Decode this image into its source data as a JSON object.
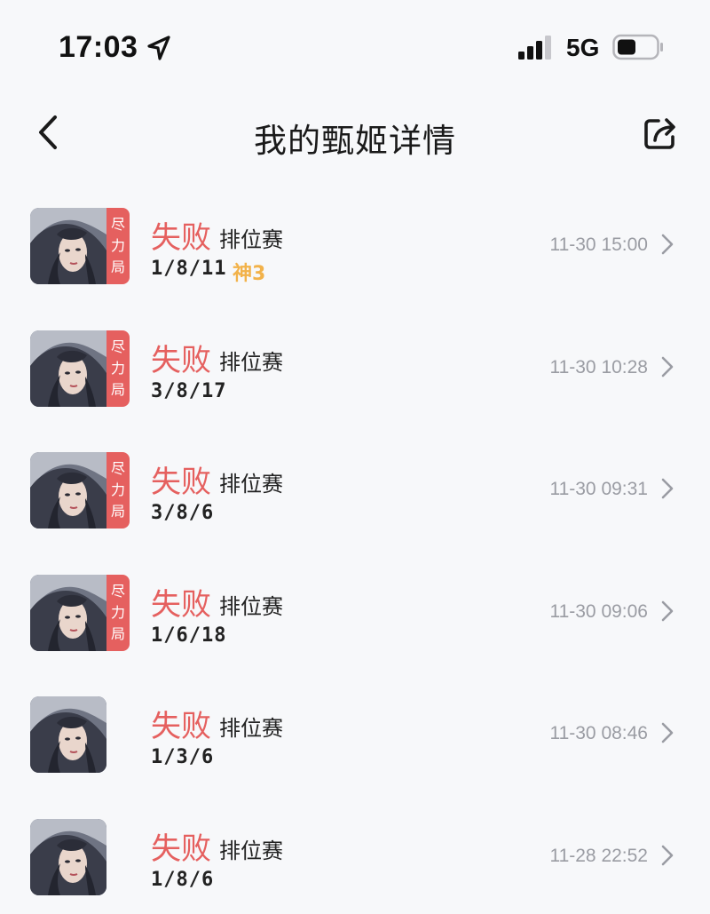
{
  "status_bar": {
    "time": "17:03",
    "network": "5G"
  },
  "nav": {
    "title": "我的甄姬详情"
  },
  "matches": [
    {
      "result": "失败",
      "mode": "排位赛",
      "kda": "1/8/11",
      "tag": "神3",
      "time": "11-30 15:00",
      "effort_badge": [
        "尽",
        "力",
        "局"
      ]
    },
    {
      "result": "失败",
      "mode": "排位赛",
      "kda": "3/8/17",
      "tag": "",
      "time": "11-30 10:28",
      "effort_badge": [
        "尽",
        "力",
        "局"
      ]
    },
    {
      "result": "失败",
      "mode": "排位赛",
      "kda": "3/8/6",
      "tag": "",
      "time": "11-30 09:31",
      "effort_badge": [
        "尽",
        "力",
        "局"
      ]
    },
    {
      "result": "失败",
      "mode": "排位赛",
      "kda": "1/6/18",
      "tag": "",
      "time": "11-30 09:06",
      "effort_badge": [
        "尽",
        "力",
        "局"
      ]
    },
    {
      "result": "失败",
      "mode": "排位赛",
      "kda": "1/3/6",
      "tag": "",
      "time": "11-30 08:46",
      "effort_badge": []
    },
    {
      "result": "失败",
      "mode": "排位赛",
      "kda": "1/8/6",
      "tag": "",
      "time": "11-28 22:52",
      "effort_badge": []
    }
  ],
  "colors": {
    "loss": "#e5605f",
    "mvp": "#f2b24a",
    "muted": "#9a9ca3"
  },
  "icons": [
    "location-arrow-icon",
    "signal-icon",
    "battery-icon",
    "back-icon",
    "share-icon",
    "chevron-right-icon"
  ]
}
